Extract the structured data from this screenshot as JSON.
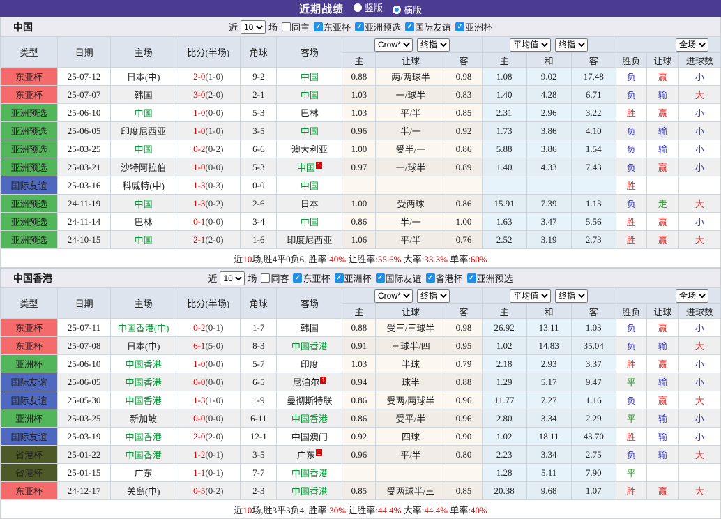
{
  "title_bar": {
    "title": "近期战绩",
    "radios": [
      {
        "label": "竖版",
        "selected": false
      },
      {
        "label": "横版",
        "selected": true
      }
    ]
  },
  "colors": {
    "title_bar_bg": "#4b3c92",
    "checkbox_checked": "#1f8fe8",
    "section_bg": "#ebebf1",
    "header_bg": "#dde4ee",
    "row_alt_bg": "#efefef",
    "odds_col_bg": "#fcf7ef",
    "avg_col_bg": "#e7f3fa",
    "team_green": "#009933",
    "score_red": "#e00000",
    "result_red": "#e03434",
    "result_blue": "#3434d6",
    "result_green": "#22a022",
    "competition_colors": {
      "东亚杯": "#f56b6b",
      "亚洲预选": "#54b65a",
      "亚洲杯": "#54b65a",
      "国际友谊": "#5069c0",
      "省港杯": "#4d5a28"
    }
  },
  "result_color_map": {
    "胜": "red",
    "负": "blue",
    "平": "green",
    "赢": "red",
    "输": "blue",
    "走": "green",
    "大": "red",
    "小": "blue"
  },
  "table_headers": {
    "left": [
      "类型",
      "日期",
      "主场",
      "比分(半场)",
      "角球",
      "客场"
    ],
    "sub": [
      "主",
      "让球",
      "客",
      "主",
      "和",
      "客",
      "胜负",
      "让球",
      "进球数"
    ],
    "dropdown_odds": [
      "Crow*",
      "终指"
    ],
    "dropdown_avg": [
      "平均值",
      "终指"
    ],
    "dropdown_full": [
      "全场"
    ]
  },
  "sections": [
    {
      "name": "中国",
      "filter": {
        "near": "近",
        "count": "10",
        "games": "场",
        "same": "同主",
        "same_checked": false,
        "competitions": [
          "东亚杯",
          "亚洲预选",
          "国际友谊",
          "亚洲杯"
        ]
      },
      "rows": [
        {
          "type": "东亚杯",
          "date": "25-07-12",
          "home": "日本(中)",
          "home_green": false,
          "home_sup": false,
          "score": "2-0",
          "half": "(1-0)",
          "corners": "9-2",
          "away": "中国",
          "away_green": true,
          "away_sup": false,
          "odds": [
            "0.88",
            "两/两球半",
            "0.98"
          ],
          "avg": [
            "1.08",
            "9.02",
            "17.48"
          ],
          "result": "负",
          "handicap": "赢",
          "goals": "小"
        },
        {
          "type": "东亚杯",
          "date": "25-07-07",
          "home": "韩国",
          "home_green": false,
          "home_sup": false,
          "score": "3-0",
          "half": "(2-0)",
          "corners": "2-1",
          "away": "中国",
          "away_green": true,
          "away_sup": false,
          "odds": [
            "1.03",
            "一/球半",
            "0.83"
          ],
          "avg": [
            "1.40",
            "4.28",
            "6.71"
          ],
          "result": "负",
          "handicap": "输",
          "goals": "大"
        },
        {
          "type": "亚洲预选",
          "date": "25-06-10",
          "home": "中国",
          "home_green": true,
          "home_sup": false,
          "score": "1-0",
          "half": "(0-0)",
          "corners": "5-3",
          "away": "巴林",
          "away_green": false,
          "away_sup": false,
          "odds": [
            "1.03",
            "平/半",
            "0.85"
          ],
          "avg": [
            "2.31",
            "2.96",
            "3.22"
          ],
          "result": "胜",
          "handicap": "赢",
          "goals": "小"
        },
        {
          "type": "亚洲预选",
          "date": "25-06-05",
          "home": "印度尼西亚",
          "home_green": false,
          "home_sup": false,
          "score": "1-0",
          "half": "(1-0)",
          "corners": "3-5",
          "away": "中国",
          "away_green": true,
          "away_sup": false,
          "odds": [
            "0.96",
            "半/一",
            "0.92"
          ],
          "avg": [
            "1.73",
            "3.86",
            "4.10"
          ],
          "result": "负",
          "handicap": "输",
          "goals": "小"
        },
        {
          "type": "亚洲预选",
          "date": "25-03-25",
          "home": "中国",
          "home_green": true,
          "home_sup": false,
          "score": "0-2",
          "half": "(0-2)",
          "corners": "6-6",
          "away": "澳大利亚",
          "away_green": false,
          "away_sup": false,
          "odds": [
            "1.00",
            "受半/一",
            "0.86"
          ],
          "avg": [
            "5.88",
            "3.86",
            "1.54"
          ],
          "result": "负",
          "handicap": "输",
          "goals": "小"
        },
        {
          "type": "亚洲预选",
          "date": "25-03-21",
          "home": "沙特阿拉伯",
          "home_green": false,
          "home_sup": false,
          "score": "1-0",
          "half": "(0-0)",
          "corners": "5-3",
          "away": "中国",
          "away_green": true,
          "away_sup": true,
          "odds": [
            "0.97",
            "一/球半",
            "0.89"
          ],
          "avg": [
            "1.40",
            "4.33",
            "7.43"
          ],
          "result": "负",
          "handicap": "赢",
          "goals": "小"
        },
        {
          "type": "国际友谊",
          "date": "25-03-16",
          "home": "科威特(中)",
          "home_green": false,
          "home_sup": false,
          "score": "1-3",
          "half": "(0-3)",
          "corners": "0-0",
          "away": "中国",
          "away_green": true,
          "away_sup": false,
          "odds": [
            "",
            "",
            ""
          ],
          "avg": [
            "",
            "",
            ""
          ],
          "result": "胜",
          "handicap": "",
          "goals": ""
        },
        {
          "type": "亚洲预选",
          "date": "24-11-19",
          "home": "中国",
          "home_green": true,
          "home_sup": false,
          "score": "1-3",
          "half": "(0-2)",
          "corners": "2-6",
          "away": "日本",
          "away_green": false,
          "away_sup": false,
          "odds": [
            "1.00",
            "受两球",
            "0.86"
          ],
          "avg": [
            "15.91",
            "7.39",
            "1.13"
          ],
          "result": "负",
          "handicap": "走",
          "goals": "大"
        },
        {
          "type": "亚洲预选",
          "date": "24-11-14",
          "home": "巴林",
          "home_green": false,
          "home_sup": false,
          "score": "0-1",
          "half": "(0-0)",
          "corners": "3-4",
          "away": "中国",
          "away_green": true,
          "away_sup": false,
          "odds": [
            "0.86",
            "半/一",
            "1.00"
          ],
          "avg": [
            "1.63",
            "3.47",
            "5.56"
          ],
          "result": "胜",
          "handicap": "赢",
          "goals": "小"
        },
        {
          "type": "亚洲预选",
          "date": "24-10-15",
          "home": "中国",
          "home_green": true,
          "home_sup": false,
          "score": "2-1",
          "half": "(2-0)",
          "corners": "1-6",
          "away": "印度尼西亚",
          "away_green": false,
          "away_sup": false,
          "odds": [
            "1.06",
            "平/半",
            "0.76"
          ],
          "avg": [
            "2.52",
            "3.19",
            "2.73"
          ],
          "result": "胜",
          "handicap": "赢",
          "goals": "大"
        }
      ],
      "summary": [
        {
          "t": "近",
          "c": "k"
        },
        {
          "t": "10",
          "c": "r"
        },
        {
          "t": "场,胜4平0负6, 胜率:",
          "c": "k"
        },
        {
          "t": "40%",
          "c": "r"
        },
        {
          "t": " 让胜率:",
          "c": "k"
        },
        {
          "t": "55.6%",
          "c": "r"
        },
        {
          "t": " 大率:",
          "c": "k"
        },
        {
          "t": "33.3%",
          "c": "r"
        },
        {
          "t": " 单率:",
          "c": "k"
        },
        {
          "t": "60%",
          "c": "r"
        }
      ]
    },
    {
      "name": "中国香港",
      "filter": {
        "near": "近",
        "count": "10",
        "games": "场",
        "same": "同客",
        "same_checked": false,
        "competitions": [
          "东亚杯",
          "亚洲杯",
          "国际友谊",
          "省港杯",
          "亚洲预选"
        ]
      },
      "rows": [
        {
          "type": "东亚杯",
          "date": "25-07-11",
          "home": "中国香港(中)",
          "home_green": true,
          "home_sup": false,
          "score": "0-2",
          "half": "(0-1)",
          "corners": "1-7",
          "away": "韩国",
          "away_green": false,
          "away_sup": false,
          "odds": [
            "0.88",
            "受三/三球半",
            "0.98"
          ],
          "avg": [
            "26.92",
            "13.11",
            "1.03"
          ],
          "result": "负",
          "handicap": "赢",
          "goals": "小"
        },
        {
          "type": "东亚杯",
          "date": "25-07-08",
          "home": "日本(中)",
          "home_green": false,
          "home_sup": false,
          "score": "6-1",
          "half": "(5-0)",
          "corners": "8-3",
          "away": "中国香港",
          "away_green": true,
          "away_sup": false,
          "odds": [
            "0.91",
            "三球半/四",
            "0.95"
          ],
          "avg": [
            "1.02",
            "14.83",
            "35.04"
          ],
          "result": "负",
          "handicap": "输",
          "goals": "大"
        },
        {
          "type": "亚洲杯",
          "date": "25-06-10",
          "home": "中国香港",
          "home_green": true,
          "home_sup": false,
          "score": "1-0",
          "half": "(0-0)",
          "corners": "5-7",
          "away": "印度",
          "away_green": false,
          "away_sup": false,
          "odds": [
            "1.03",
            "半球",
            "0.79"
          ],
          "avg": [
            "2.18",
            "2.93",
            "3.37"
          ],
          "result": "胜",
          "handicap": "赢",
          "goals": "小"
        },
        {
          "type": "国际友谊",
          "date": "25-06-05",
          "home": "中国香港",
          "home_green": true,
          "home_sup": false,
          "score": "0-0",
          "half": "(0-0)",
          "corners": "6-5",
          "away": "尼泊尔",
          "away_green": false,
          "away_sup": true,
          "odds": [
            "0.94",
            "球半",
            "0.88"
          ],
          "avg": [
            "1.29",
            "5.17",
            "9.47"
          ],
          "result": "平",
          "handicap": "输",
          "goals": "小"
        },
        {
          "type": "国际友谊",
          "date": "25-05-30",
          "home": "中国香港",
          "home_green": true,
          "home_sup": false,
          "score": "1-3",
          "half": "(1-0)",
          "corners": "1-9",
          "away": "曼彻斯特联",
          "away_green": false,
          "away_sup": false,
          "odds": [
            "0.86",
            "受两/两球半",
            "0.96"
          ],
          "avg": [
            "11.77",
            "7.27",
            "1.16"
          ],
          "result": "负",
          "handicap": "赢",
          "goals": "大"
        },
        {
          "type": "亚洲杯",
          "date": "25-03-25",
          "home": "新加坡",
          "home_green": false,
          "home_sup": false,
          "score": "0-0",
          "half": "(0-0)",
          "corners": "6-11",
          "away": "中国香港",
          "away_green": true,
          "away_sup": false,
          "odds": [
            "0.86",
            "受平/半",
            "0.96"
          ],
          "avg": [
            "2.80",
            "3.34",
            "2.29"
          ],
          "result": "平",
          "handicap": "输",
          "goals": "小"
        },
        {
          "type": "国际友谊",
          "date": "25-03-19",
          "home": "中国香港",
          "home_green": true,
          "home_sup": false,
          "score": "2-0",
          "half": "(2-0)",
          "corners": "12-1",
          "away": "中国澳门",
          "away_green": false,
          "away_sup": false,
          "odds": [
            "0.92",
            "四球",
            "0.90"
          ],
          "avg": [
            "1.02",
            "18.11",
            "43.70"
          ],
          "result": "胜",
          "handicap": "输",
          "goals": "小"
        },
        {
          "type": "省港杯",
          "date": "25-01-22",
          "home": "中国香港",
          "home_green": true,
          "home_sup": false,
          "score": "1-2",
          "half": "(0-1)",
          "corners": "3-5",
          "away": "广东",
          "away_green": false,
          "away_sup": true,
          "odds": [
            "0.96",
            "平/半",
            "0.80"
          ],
          "avg": [
            "2.23",
            "3.34",
            "2.75"
          ],
          "result": "负",
          "handicap": "输",
          "goals": "大"
        },
        {
          "type": "省港杯",
          "date": "25-01-15",
          "home": "广东",
          "home_green": false,
          "home_sup": false,
          "score": "1-1",
          "half": "(0-1)",
          "corners": "7-7",
          "away": "中国香港",
          "away_green": true,
          "away_sup": false,
          "odds": [
            "",
            "",
            ""
          ],
          "avg": [
            "1.28",
            "5.11",
            "7.90"
          ],
          "result": "平",
          "handicap": "",
          "goals": ""
        },
        {
          "type": "东亚杯",
          "date": "24-12-17",
          "home": "关岛(中)",
          "home_green": false,
          "home_sup": false,
          "score": "0-5",
          "half": "(0-2)",
          "corners": "2-3",
          "away": "中国香港",
          "away_green": true,
          "away_sup": false,
          "odds": [
            "0.85",
            "受两球半/三",
            "0.85"
          ],
          "avg": [
            "20.38",
            "9.68",
            "1.07"
          ],
          "result": "胜",
          "handicap": "赢",
          "goals": "大"
        }
      ],
      "summary": [
        {
          "t": "近",
          "c": "k"
        },
        {
          "t": "10",
          "c": "r"
        },
        {
          "t": "场,胜3平3负4, 胜率:",
          "c": "k"
        },
        {
          "t": "30%",
          "c": "r"
        },
        {
          "t": " 让胜率:",
          "c": "k"
        },
        {
          "t": "44.4%",
          "c": "r"
        },
        {
          "t": " 大率:",
          "c": "k"
        },
        {
          "t": "44.4%",
          "c": "r"
        },
        {
          "t": " 单率:",
          "c": "k"
        },
        {
          "t": "40%",
          "c": "r"
        }
      ]
    }
  ]
}
